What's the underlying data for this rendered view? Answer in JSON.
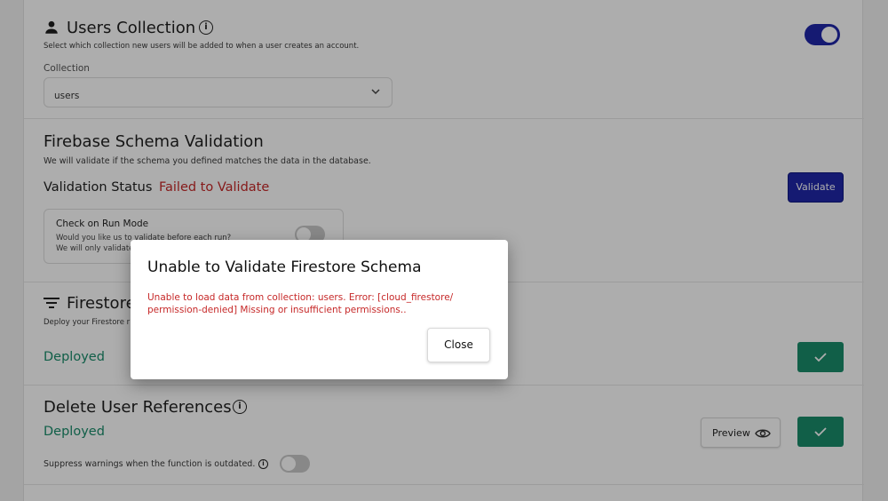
{
  "users_collection": {
    "title": "Users Collection",
    "description": "Select which collection new users will be added to when a user creates an account.",
    "collection_label": "Collection",
    "collection_value": "users",
    "toggle_state": "on"
  },
  "schema_validation": {
    "title": "Firebase Schema Validation",
    "description": "We will validate if the schema you defined matches the data in the database.",
    "status_label": "Validation Status",
    "status_value": "Failed to Validate",
    "validate_button": "Validate",
    "run_mode": {
      "title": "Check on Run Mode",
      "line1": "Would you like us to validate before each run?",
      "line2": "We will only validate o"
    }
  },
  "firestore_rules": {
    "title": "Firestore",
    "description": "Deploy your Firestore r",
    "status": "Deployed"
  },
  "delete_user_references": {
    "title": "Delete User References",
    "status": "Deployed",
    "preview_button": "Preview",
    "suppress_label": "Suppress warnings when the function is outdated."
  },
  "modal": {
    "title": "Unable to Validate Firestore Schema",
    "message": "Unable to load data from collection: users. Error: [cloud_firestore/ permission-denied] Missing or insufficient permissions..",
    "close_button": "Close"
  },
  "colors": {
    "accent": "#1f27a8",
    "error": "#c62828",
    "success": "#1a8c6b"
  }
}
